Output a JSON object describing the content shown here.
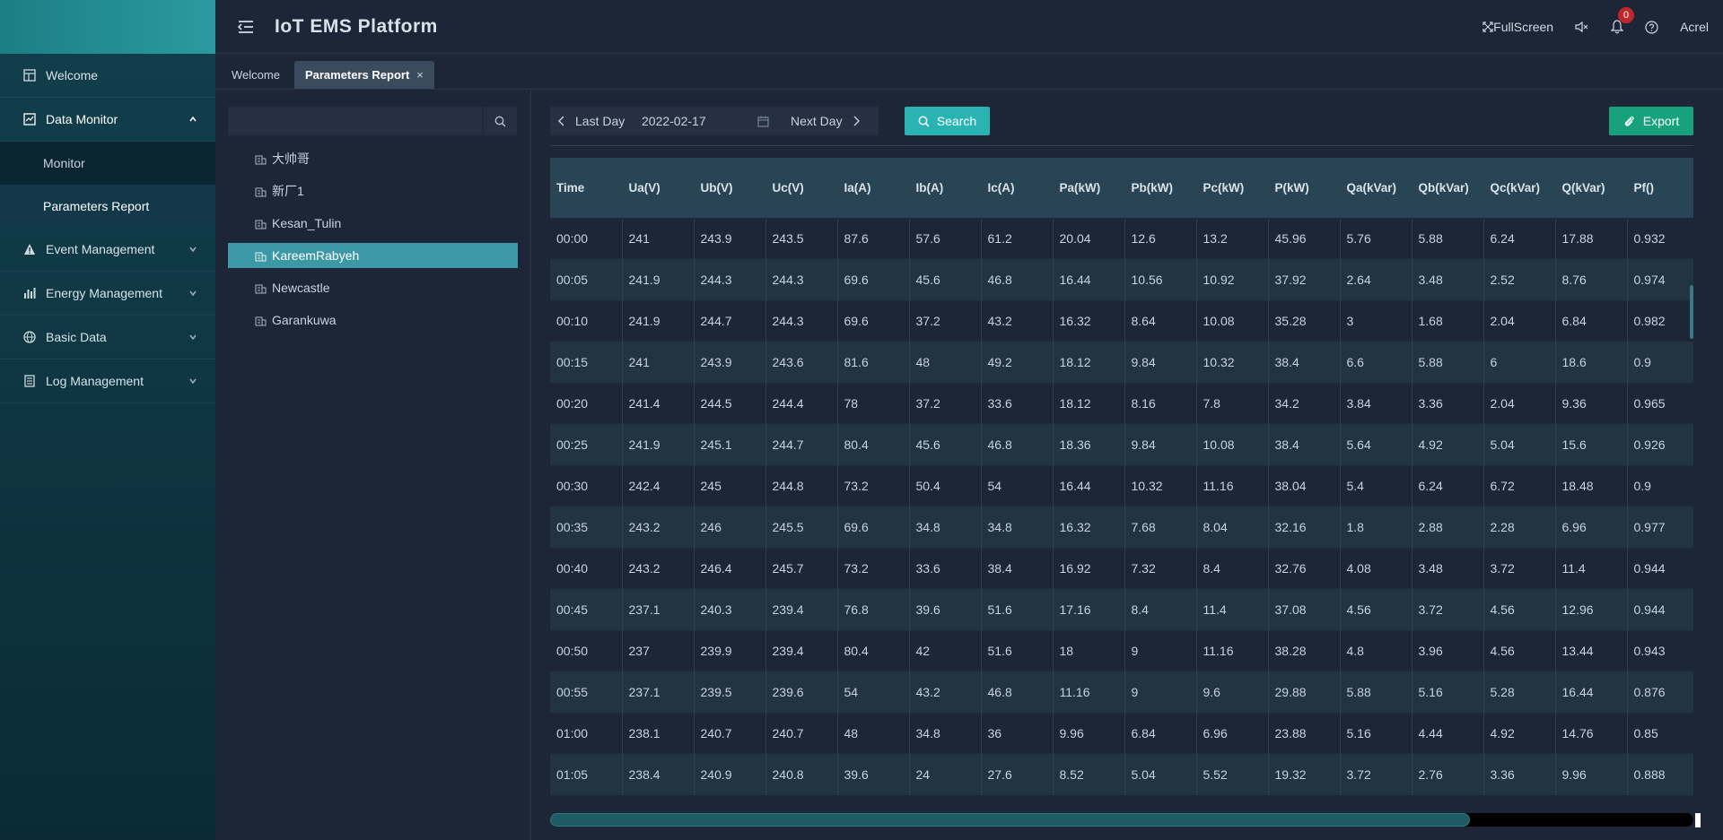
{
  "header": {
    "title": "IoT EMS Platform",
    "fullscreen_label": "FullScreen",
    "notification_count": "0",
    "user": "Acrel"
  },
  "sidebar": {
    "items": [
      {
        "label": "Welcome",
        "icon": "dashboard-icon"
      },
      {
        "label": "Data Monitor",
        "icon": "monitor-icon",
        "open": true,
        "children": [
          {
            "label": "Monitor"
          },
          {
            "label": "Parameters Report",
            "active": true
          }
        ]
      },
      {
        "label": "Event Management",
        "icon": "warning-icon"
      },
      {
        "label": "Energy Management",
        "icon": "bar-chart-icon"
      },
      {
        "label": "Basic Data",
        "icon": "globe-icon"
      },
      {
        "label": "Log Management",
        "icon": "log-icon"
      }
    ]
  },
  "tabs": [
    {
      "label": "Welcome"
    },
    {
      "label": "Parameters Report",
      "active": true,
      "close": "×"
    }
  ],
  "tree": {
    "search_value": "",
    "items": [
      {
        "label": "大帅哥"
      },
      {
        "label": "新厂1"
      },
      {
        "label": "Kesan_Tulin"
      },
      {
        "label": "KareemRabyeh",
        "selected": true
      },
      {
        "label": "Newcastle"
      },
      {
        "label": "Garankuwa"
      }
    ]
  },
  "toolbar": {
    "last_day": "Last Day",
    "date": "2022-02-17",
    "next_day": "Next Day",
    "search": "Search",
    "export": "Export"
  },
  "table": {
    "columns": [
      "Time",
      "Ua(V)",
      "Ub(V)",
      "Uc(V)",
      "Ia(A)",
      "Ib(A)",
      "Ic(A)",
      "Pa(kW)",
      "Pb(kW)",
      "Pc(kW)",
      "P(kW)",
      "Qa(kVar)",
      "Qb(kVar)",
      "Qc(kVar)",
      "Q(kVar)",
      "Pf()"
    ],
    "rows": [
      [
        "00:00",
        "241",
        "243.9",
        "243.5",
        "87.6",
        "57.6",
        "61.2",
        "20.04",
        "12.6",
        "13.2",
        "45.96",
        "5.76",
        "5.88",
        "6.24",
        "17.88",
        "0.932"
      ],
      [
        "00:05",
        "241.9",
        "244.3",
        "244.3",
        "69.6",
        "45.6",
        "46.8",
        "16.44",
        "10.56",
        "10.92",
        "37.92",
        "2.64",
        "3.48",
        "2.52",
        "8.76",
        "0.974"
      ],
      [
        "00:10",
        "241.9",
        "244.7",
        "244.3",
        "69.6",
        "37.2",
        "43.2",
        "16.32",
        "8.64",
        "10.08",
        "35.28",
        "3",
        "1.68",
        "2.04",
        "6.84",
        "0.982"
      ],
      [
        "00:15",
        "241",
        "243.9",
        "243.6",
        "81.6",
        "48",
        "49.2",
        "18.12",
        "9.84",
        "10.32",
        "38.4",
        "6.6",
        "5.88",
        "6",
        "18.6",
        "0.9"
      ],
      [
        "00:20",
        "241.4",
        "244.5",
        "244.4",
        "78",
        "37.2",
        "33.6",
        "18.12",
        "8.16",
        "7.8",
        "34.2",
        "3.84",
        "3.36",
        "2.04",
        "9.36",
        "0.965"
      ],
      [
        "00:25",
        "241.9",
        "245.1",
        "244.7",
        "80.4",
        "45.6",
        "46.8",
        "18.36",
        "9.84",
        "10.08",
        "38.4",
        "5.64",
        "4.92",
        "5.04",
        "15.6",
        "0.926"
      ],
      [
        "00:30",
        "242.4",
        "245",
        "244.8",
        "73.2",
        "50.4",
        "54",
        "16.44",
        "10.32",
        "11.16",
        "38.04",
        "5.4",
        "6.24",
        "6.72",
        "18.48",
        "0.9"
      ],
      [
        "00:35",
        "243.2",
        "246",
        "245.5",
        "69.6",
        "34.8",
        "34.8",
        "16.32",
        "7.68",
        "8.04",
        "32.16",
        "1.8",
        "2.88",
        "2.28",
        "6.96",
        "0.977"
      ],
      [
        "00:40",
        "243.2",
        "246.4",
        "245.7",
        "73.2",
        "33.6",
        "38.4",
        "16.92",
        "7.32",
        "8.4",
        "32.76",
        "4.08",
        "3.48",
        "3.72",
        "11.4",
        "0.944"
      ],
      [
        "00:45",
        "237.1",
        "240.3",
        "239.4",
        "76.8",
        "39.6",
        "51.6",
        "17.16",
        "8.4",
        "11.4",
        "37.08",
        "4.56",
        "3.72",
        "4.56",
        "12.96",
        "0.944"
      ],
      [
        "00:50",
        "237",
        "239.9",
        "239.4",
        "80.4",
        "42",
        "51.6",
        "18",
        "9",
        "11.16",
        "38.28",
        "4.8",
        "3.96",
        "4.56",
        "13.44",
        "0.943"
      ],
      [
        "00:55",
        "237.1",
        "239.5",
        "239.6",
        "54",
        "43.2",
        "46.8",
        "11.16",
        "9",
        "9.6",
        "29.88",
        "5.88",
        "5.16",
        "5.28",
        "16.44",
        "0.876"
      ],
      [
        "01:00",
        "238.1",
        "240.7",
        "240.7",
        "48",
        "34.8",
        "36",
        "9.96",
        "6.84",
        "6.96",
        "23.88",
        "5.16",
        "4.44",
        "4.92",
        "14.76",
        "0.85"
      ],
      [
        "01:05",
        "238.4",
        "240.9",
        "240.8",
        "39.6",
        "24",
        "27.6",
        "8.52",
        "5.04",
        "5.52",
        "19.32",
        "3.72",
        "2.76",
        "3.36",
        "9.96",
        "0.888"
      ]
    ]
  }
}
